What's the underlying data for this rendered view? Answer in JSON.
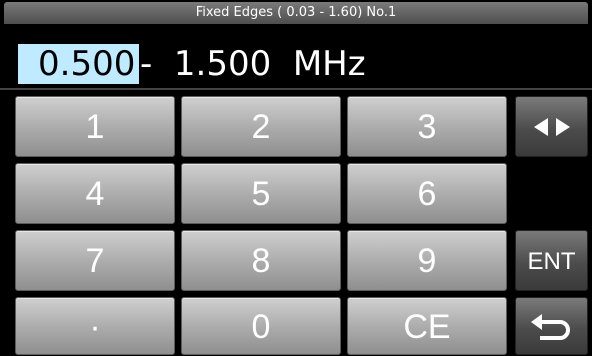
{
  "title": "Fixed Edges ( 0.03 -  1.60) No.1",
  "frequency": {
    "start": "0.500",
    "rest": "-  1.500  MHz"
  },
  "keypad": {
    "k1": "1",
    "k2": "2",
    "k3": "3",
    "k4": "4",
    "k5": "5",
    "k6": "6",
    "k7": "7",
    "k8": "8",
    "k9": "9",
    "dot": "·",
    "k0": "0",
    "ce": "CE"
  },
  "side": {
    "ent": "ENT",
    "swap_icon": "left-right-arrows-icon",
    "back_icon": "return-icon"
  }
}
